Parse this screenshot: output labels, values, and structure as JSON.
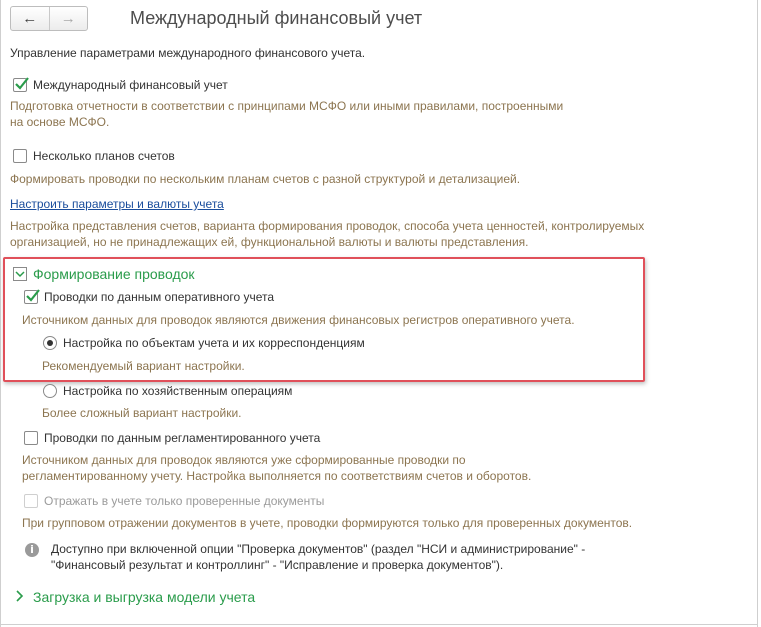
{
  "window": {
    "title": "Международный финансовый учет",
    "nav": {
      "back_icon": "←",
      "forward_icon": "→"
    }
  },
  "header_text": "Управление параметрами международного финансового учета.",
  "options": {
    "msfo": {
      "label": "Международный финансовый учет",
      "checked": true,
      "desc_line1": "Подготовка отчетности в соответствии с принципами МСФО или иными правилами, построенными",
      "desc_line2": "на основе МСФО."
    },
    "multi_plans": {
      "label": "Несколько планов счетов",
      "checked": false,
      "desc": "Формировать проводки по нескольким планам счетов с разной структурой и детализацией."
    },
    "settings_link": {
      "label": "Настроить параметры и валюты учета",
      "desc_line1": "Настройка представления счетов, варианта формирования проводок, способа учета ценностей, контролируемых",
      "desc_line2": "организацией, но не принадлежащих ей, функциональной валюты и валюты представления."
    }
  },
  "postings_group": {
    "title": "Формирование проводок",
    "operational": {
      "label": "Проводки по данным оперативного учета",
      "checked": true,
      "desc": "Источником данных для проводок являются движения финансовых регистров оперативного учета.",
      "radio1": {
        "label": "Настройка по объектам учета и их корреспонденциям",
        "selected": true,
        "desc": "Рекомендуемый вариант настройки."
      },
      "radio2": {
        "label": "Настройка по хозяйственным операциям",
        "selected": false,
        "desc": "Более сложный вариант настройки."
      }
    },
    "regulated": {
      "label": "Проводки по данным регламентированного учета",
      "checked": false,
      "desc_line1": "Источником данных для проводок являются уже сформированные проводки по",
      "desc_line2": "регламентированному учету. Настройка выполняется по соответствиям счетов и оборотов."
    },
    "verified_only": {
      "label": "Отражать в учете только проверенные документы",
      "checked": false,
      "disabled": true,
      "desc": "При групповом отражении документов в учете, проводки формируются только для проверенных документов."
    },
    "info": {
      "icon": "i",
      "line1": "Доступно при включенной опции \"Проверка документов\" (раздел \"НСИ и администрирование\" -",
      "line2": "\"Финансовый результат и контроллинг\" - \"Исправление и проверка документов\")."
    }
  },
  "model_group": {
    "title": "Загрузка и выгрузка модели учета"
  },
  "colors": {
    "accent_green": "#2a9c4b",
    "description": "#8c7550",
    "link": "#1a4d9c",
    "highlight_border": "#e0505a"
  }
}
